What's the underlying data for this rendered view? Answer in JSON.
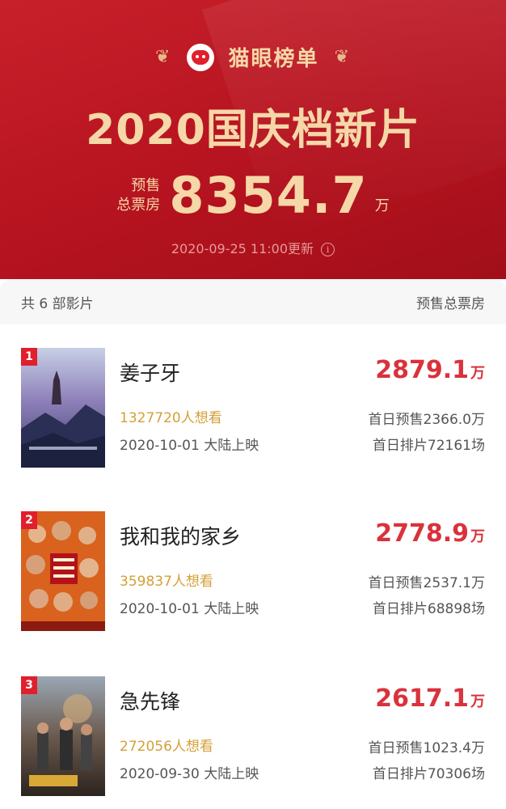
{
  "header": {
    "brand": "猫眼榜单",
    "title": "2020国庆档新片",
    "presale_label_line1": "预售",
    "presale_label_line2": "总票房",
    "presale_total": "8354.7",
    "presale_unit": "万",
    "updated": "2020-09-25 11:00更新",
    "info_icon": "i"
  },
  "list": {
    "count_label": "共 6 部影片",
    "column_label": "预售总票房"
  },
  "movies": [
    {
      "rank": "1",
      "name": "姜子牙",
      "want": "1327720人想看",
      "release": "2020-10-01 大陆上映",
      "box": "2879.1",
      "unit": "万",
      "first_day_presale": "首日预售2366.0万",
      "first_day_screenings": "首日排片72161场"
    },
    {
      "rank": "2",
      "name": "我和我的家乡",
      "want": "359837人想看",
      "release": "2020-10-01 大陆上映",
      "box": "2778.9",
      "unit": "万",
      "first_day_presale": "首日预售2537.1万",
      "first_day_screenings": "首日排片68898场"
    },
    {
      "rank": "3",
      "name": "急先锋",
      "want": "272056人想看",
      "release": "2020-09-30 大陆上映",
      "box": "2617.1",
      "unit": "万",
      "first_day_presale": "首日预售1023.4万",
      "first_day_screenings": "首日排片70306场"
    }
  ],
  "colors": {
    "header_bg": "#b5131f",
    "gold_text": "#f6d7a8",
    "box_office_red": "#d9323c",
    "want_gold": "#d4a037",
    "rank_badge": "#e0202c"
  }
}
